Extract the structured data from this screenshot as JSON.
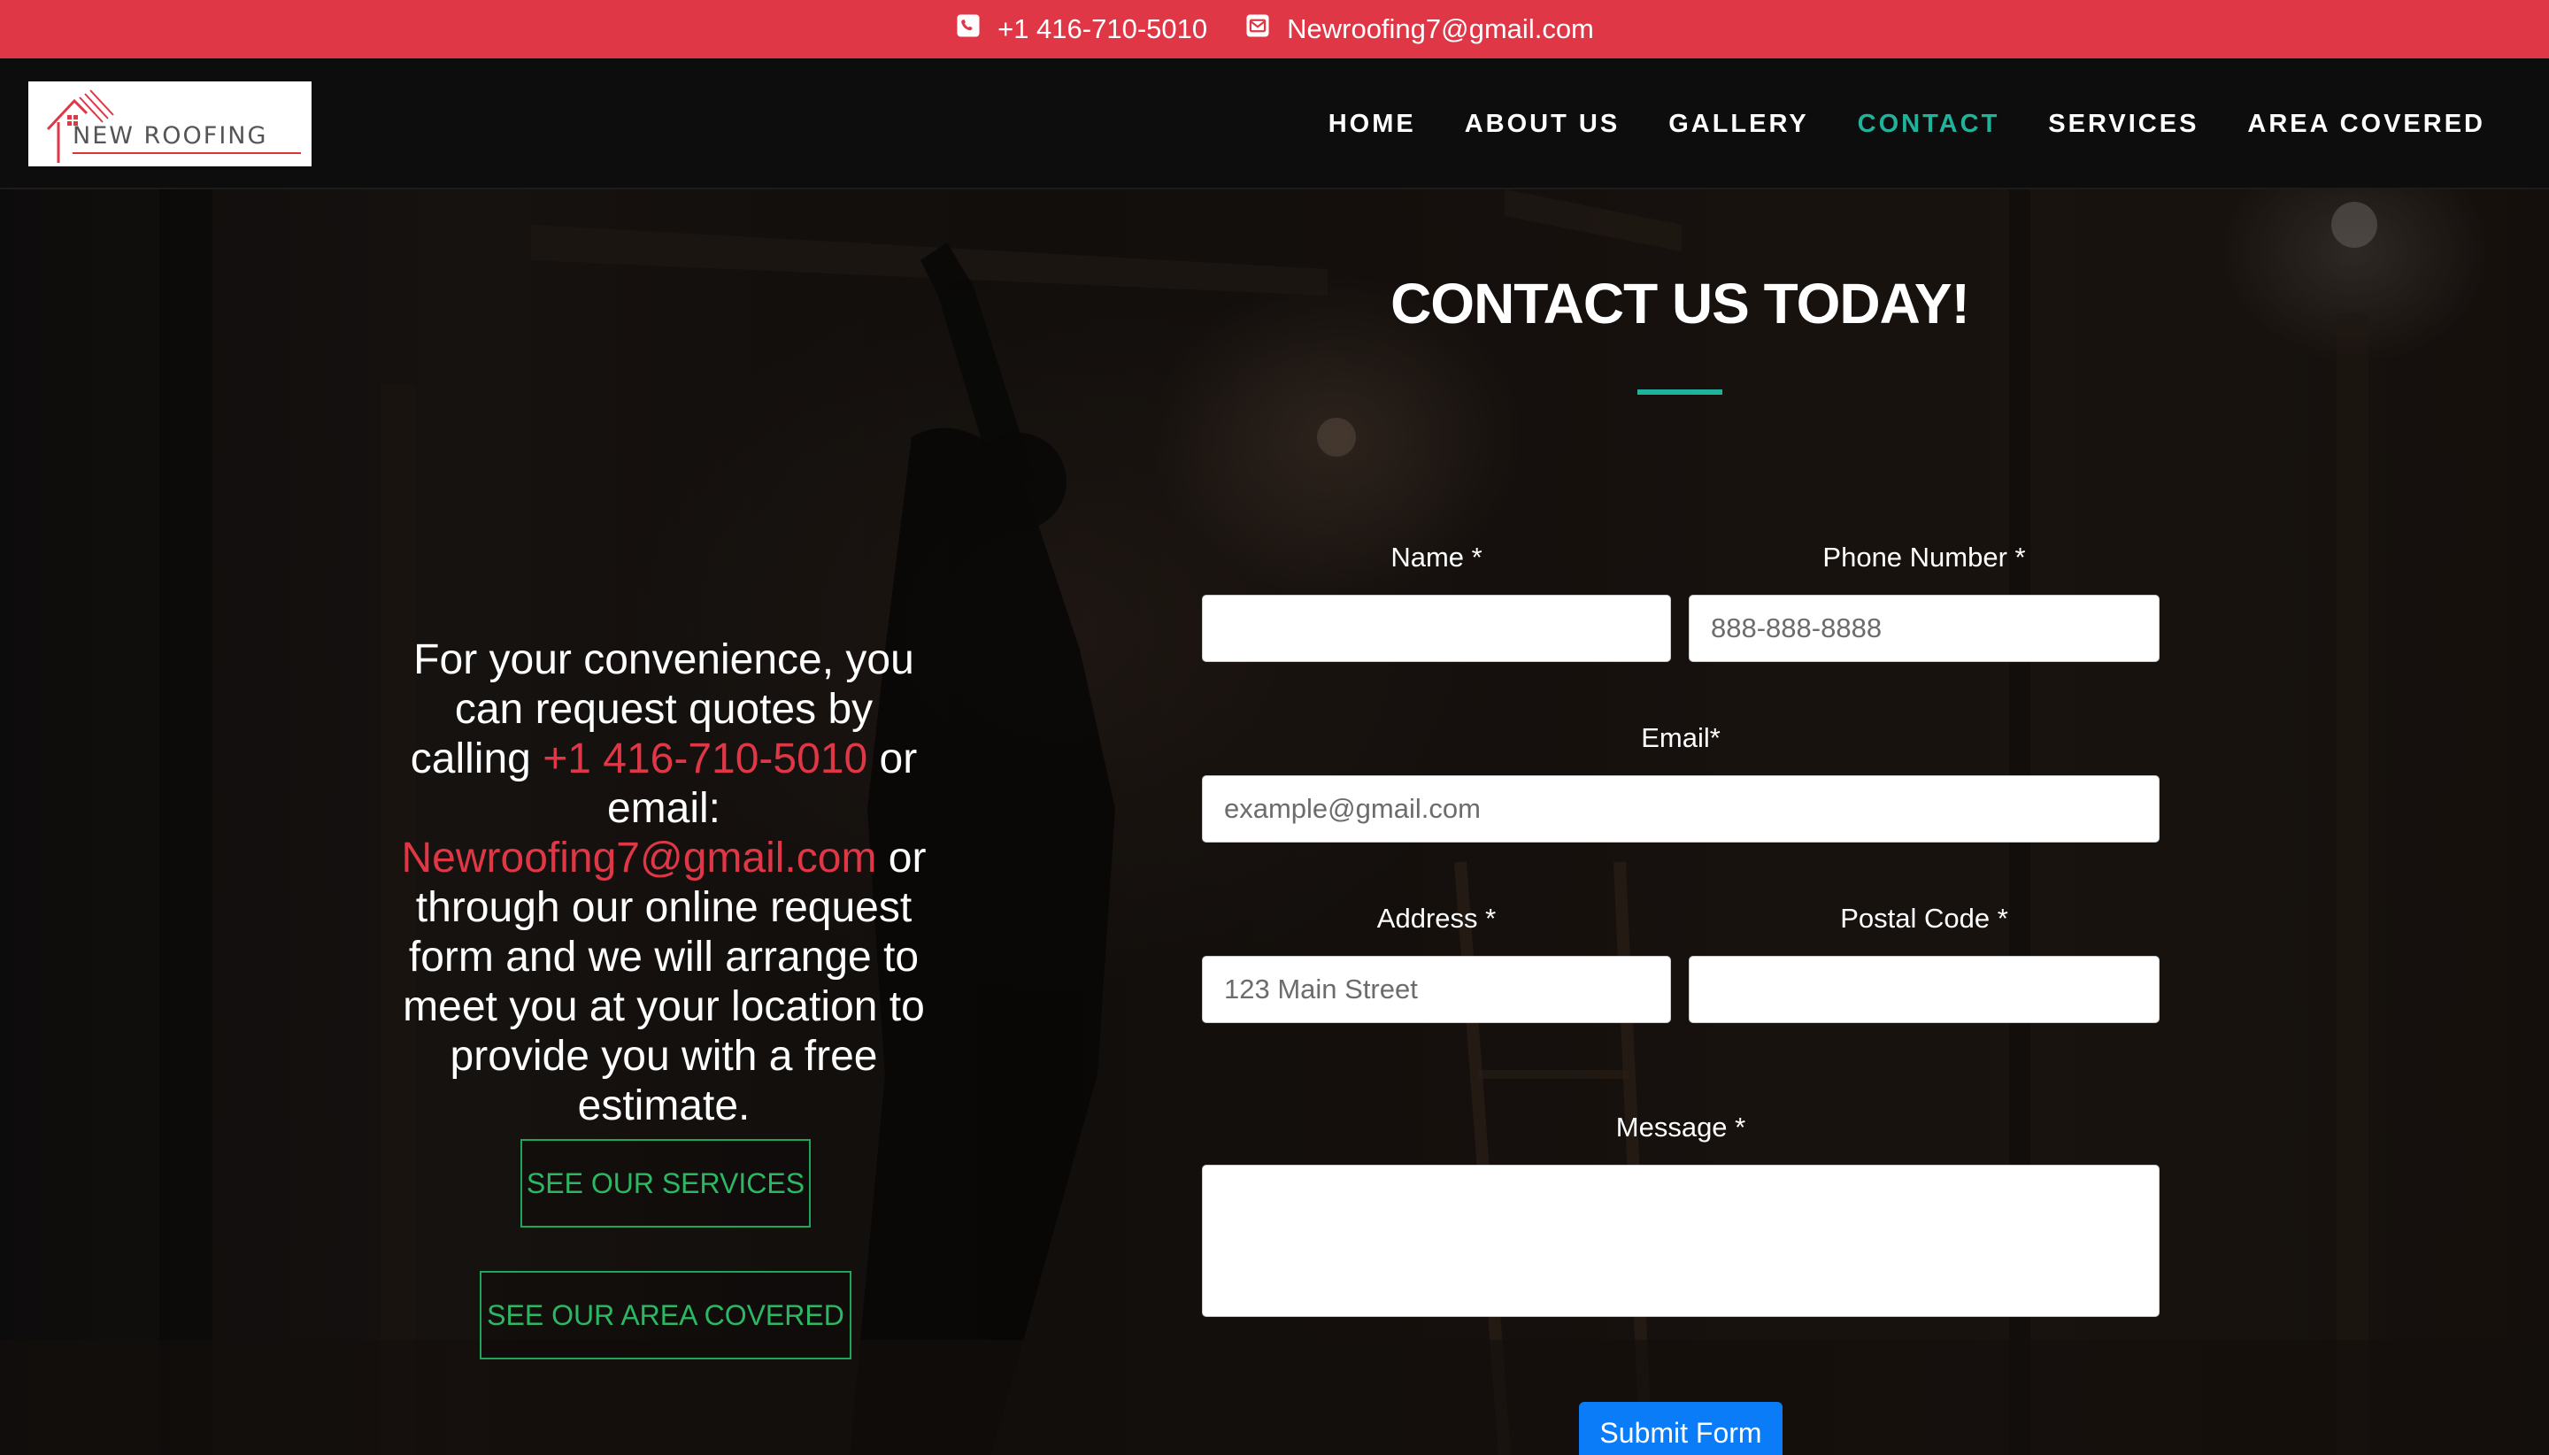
{
  "topbar": {
    "phone": "+1 416-710-5010",
    "email": "Newroofing7@gmail.com",
    "phone_icon": "phone-square-icon",
    "email_icon": "envelope-icon"
  },
  "header": {
    "logo_text": "NEW ROOFING",
    "nav": [
      {
        "label": "HOME"
      },
      {
        "label": "ABOUT US"
      },
      {
        "label": "GALLERY"
      },
      {
        "label": "CONTACT"
      },
      {
        "label": "SERVICES"
      },
      {
        "label": "AREA COVERED"
      }
    ],
    "active_nav": "CONTACT"
  },
  "intro": {
    "line_a": "For your convenience, you can request quotes by calling ",
    "phone": "+1 416-710-5010",
    "line_b": " or email: ",
    "email": "Newroofing7@gmail.com",
    "line_c": " or through our online request form and we will arrange to meet you at your location to provide you with a free estimate."
  },
  "buttons": {
    "services": "SEE OUR SERVICES",
    "area": "SEE OUR AREA COVERED"
  },
  "form": {
    "title": "CONTACT US TODAY!",
    "name_label": "Name *",
    "name_placeholder": "",
    "phone_label": "Phone Number *",
    "phone_placeholder": "888-888-8888",
    "email_label": "Email*",
    "email_placeholder": "example@gmail.com",
    "address_label": "Address *",
    "address_placeholder": "123 Main Street",
    "postal_label": "Postal Code *",
    "postal_placeholder": "",
    "message_label": "Message *",
    "submit": "Submit Form"
  },
  "colors": {
    "topbar": "#e03747",
    "accent_teal": "#1fb39b",
    "link_red": "#e03747",
    "button_green": "#1fa65a",
    "submit_blue": "#0a7cf7"
  }
}
